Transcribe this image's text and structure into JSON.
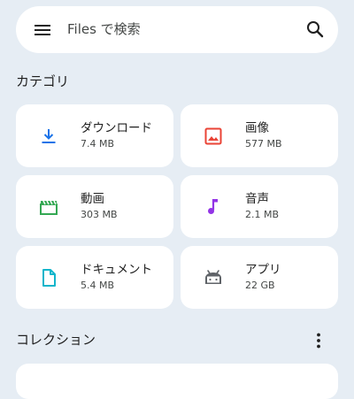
{
  "search": {
    "placeholder": "Files で検索",
    "menu_icon": "menu-icon",
    "search_icon": "search-icon"
  },
  "categories": {
    "title": "カテゴリ",
    "items": [
      {
        "label": "ダウンロード",
        "size": "7.4 MB",
        "icon": "download-icon",
        "color": "#1a73e8"
      },
      {
        "label": "画像",
        "size": "577 MB",
        "icon": "image-icon",
        "color": "#ea4335"
      },
      {
        "label": "動画",
        "size": "303 MB",
        "icon": "video-icon",
        "color": "#34a853"
      },
      {
        "label": "音声",
        "size": "2.1 MB",
        "icon": "audio-icon",
        "color": "#9334e6"
      },
      {
        "label": "ドキュメント",
        "size": "5.4 MB",
        "icon": "document-icon",
        "color": "#12b5cb"
      },
      {
        "label": "アプリ",
        "size": "22 GB",
        "icon": "android-icon",
        "color": "#5f6368"
      }
    ]
  },
  "collections": {
    "title": "コレクション",
    "more_icon": "more-vert-icon"
  }
}
